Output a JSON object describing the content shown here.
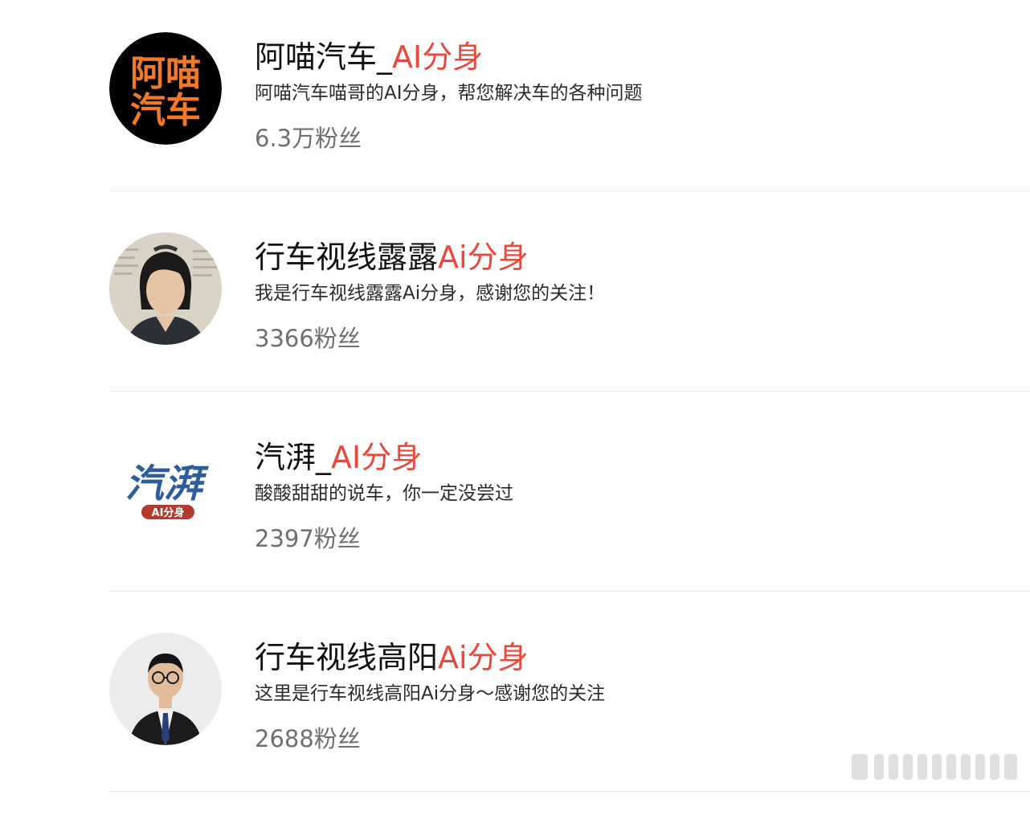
{
  "accounts": [
    {
      "name": "阿喵汽车_",
      "name_tag": "AI分身",
      "description": "阿喵汽车喵哥的AI分身，帮您解决车的各种问题",
      "fans": "6.3万粉丝",
      "avatar_text_top": "阿喵",
      "avatar_text_bottom": "汽车"
    },
    {
      "name": "行车视线露露",
      "name_tag": "Ai分身",
      "description": "我是行车视线露露Ai分身，感谢您的关注！",
      "fans": "3366粉丝"
    },
    {
      "name": "汽湃_",
      "name_tag": "AI分身",
      "description": "酸酸甜甜的说车，你一定没尝过",
      "fans": "2397粉丝",
      "avatar_text": "汽湃",
      "avatar_badge": "AI分身"
    },
    {
      "name": "行车视线高阳",
      "name_tag": "Ai分身",
      "description": "这里是行车视线高阳Ai分身～感谢您的关注",
      "fans": "2688粉丝"
    }
  ],
  "colors": {
    "tag": "#e9483b",
    "divider": "#e8e8e8",
    "fans_text": "#6f6f6f",
    "logo_orange": "#f07a2a"
  }
}
